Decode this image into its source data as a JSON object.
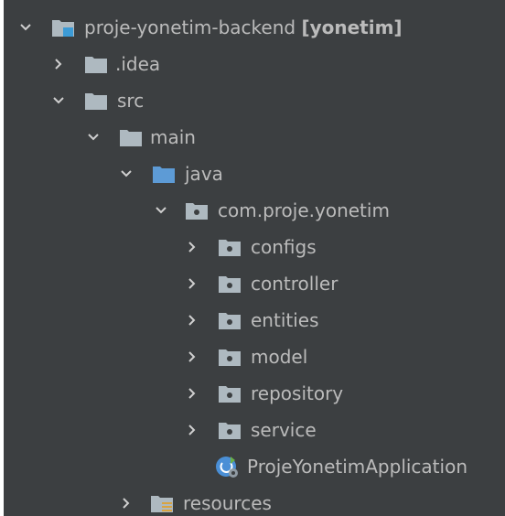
{
  "project_tree": {
    "root": {
      "label": "proje-yonetim-backend",
      "module": "[yonetim]",
      "icon": "module-folder-icon",
      "expanded": true
    },
    "idea": {
      "label": ".idea",
      "icon": "folder-icon",
      "expanded": false
    },
    "src": {
      "label": "src",
      "icon": "folder-icon",
      "expanded": true
    },
    "main": {
      "label": "main",
      "icon": "folder-icon",
      "expanded": true
    },
    "java": {
      "label": "java",
      "icon": "source-root-folder-icon",
      "expanded": true
    },
    "package": {
      "label": "com.proje.yonetim",
      "icon": "package-icon",
      "expanded": true
    },
    "configs": {
      "label": "configs",
      "icon": "package-icon",
      "expanded": false
    },
    "controller": {
      "label": "controller",
      "icon": "package-icon",
      "expanded": false
    },
    "entities": {
      "label": "entities",
      "icon": "package-icon",
      "expanded": false
    },
    "model": {
      "label": "model",
      "icon": "package-icon",
      "expanded": false
    },
    "repository": {
      "label": "repository",
      "icon": "package-icon",
      "expanded": false
    },
    "service": {
      "label": "service",
      "icon": "package-icon",
      "expanded": false
    },
    "application": {
      "label": "ProjeYonetimApplication",
      "icon": "spring-boot-class-icon"
    },
    "resources": {
      "label": "resources",
      "icon": "resources-folder-icon",
      "expanded": false
    }
  },
  "colors": {
    "background": "#3c3f41",
    "text": "#bbbbbb",
    "folder": "#aeb9c0",
    "source_root": "#5d9bd6",
    "chevron": "#cfcfcf"
  }
}
